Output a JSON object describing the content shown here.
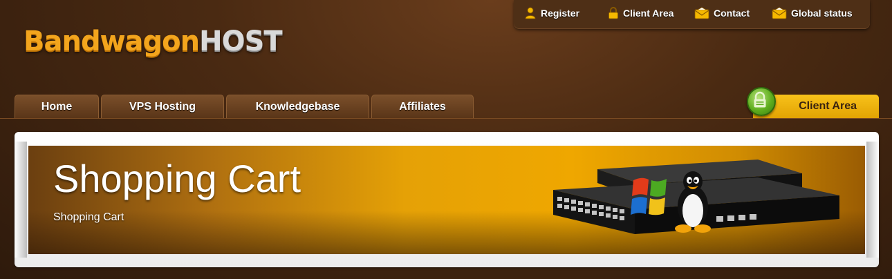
{
  "logo": {
    "part1": "Bandwagon",
    "part2": "HOST"
  },
  "topbar": {
    "links": [
      {
        "label": "Register",
        "icon": "user-icon"
      },
      {
        "label": "Client Area",
        "icon": "lock-icon"
      },
      {
        "label": "Contact",
        "icon": "envelope-icon"
      },
      {
        "label": "Global status",
        "icon": "envelope-icon"
      }
    ]
  },
  "nav": {
    "tabs": [
      {
        "label": "Home"
      },
      {
        "label": "VPS Hosting"
      },
      {
        "label": "Knowledgebase"
      },
      {
        "label": "Affiliates"
      }
    ],
    "client_area": "Client Area"
  },
  "banner": {
    "title": "Shopping Cart",
    "subtitle": "Shopping Cart"
  },
  "colors": {
    "brand_orange": "#f3a51d",
    "background_brown": "#4a2a12",
    "client_area_yellow": "#f8c21a",
    "lock_green": "#5fae1e"
  }
}
